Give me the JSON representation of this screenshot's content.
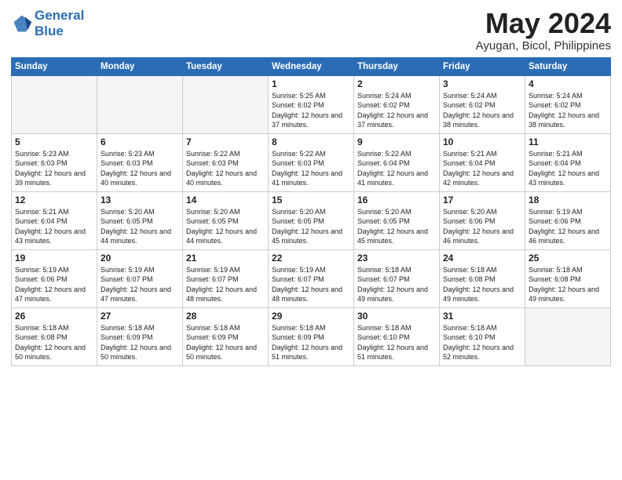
{
  "header": {
    "logo_line1": "General",
    "logo_line2": "Blue",
    "month": "May 2024",
    "location": "Ayugan, Bicol, Philippines"
  },
  "weekdays": [
    "Sunday",
    "Monday",
    "Tuesday",
    "Wednesday",
    "Thursday",
    "Friday",
    "Saturday"
  ],
  "weeks": [
    [
      {
        "day": "",
        "info": ""
      },
      {
        "day": "",
        "info": ""
      },
      {
        "day": "",
        "info": ""
      },
      {
        "day": "1",
        "info": "Sunrise: 5:25 AM\nSunset: 6:02 PM\nDaylight: 12 hours\nand 37 minutes."
      },
      {
        "day": "2",
        "info": "Sunrise: 5:24 AM\nSunset: 6:02 PM\nDaylight: 12 hours\nand 37 minutes."
      },
      {
        "day": "3",
        "info": "Sunrise: 5:24 AM\nSunset: 6:02 PM\nDaylight: 12 hours\nand 38 minutes."
      },
      {
        "day": "4",
        "info": "Sunrise: 5:24 AM\nSunset: 6:02 PM\nDaylight: 12 hours\nand 38 minutes."
      }
    ],
    [
      {
        "day": "5",
        "info": "Sunrise: 5:23 AM\nSunset: 6:03 PM\nDaylight: 12 hours\nand 39 minutes."
      },
      {
        "day": "6",
        "info": "Sunrise: 5:23 AM\nSunset: 6:03 PM\nDaylight: 12 hours\nand 40 minutes."
      },
      {
        "day": "7",
        "info": "Sunrise: 5:22 AM\nSunset: 6:03 PM\nDaylight: 12 hours\nand 40 minutes."
      },
      {
        "day": "8",
        "info": "Sunrise: 5:22 AM\nSunset: 6:03 PM\nDaylight: 12 hours\nand 41 minutes."
      },
      {
        "day": "9",
        "info": "Sunrise: 5:22 AM\nSunset: 6:04 PM\nDaylight: 12 hours\nand 41 minutes."
      },
      {
        "day": "10",
        "info": "Sunrise: 5:21 AM\nSunset: 6:04 PM\nDaylight: 12 hours\nand 42 minutes."
      },
      {
        "day": "11",
        "info": "Sunrise: 5:21 AM\nSunset: 6:04 PM\nDaylight: 12 hours\nand 43 minutes."
      }
    ],
    [
      {
        "day": "12",
        "info": "Sunrise: 5:21 AM\nSunset: 6:04 PM\nDaylight: 12 hours\nand 43 minutes."
      },
      {
        "day": "13",
        "info": "Sunrise: 5:20 AM\nSunset: 6:05 PM\nDaylight: 12 hours\nand 44 minutes."
      },
      {
        "day": "14",
        "info": "Sunrise: 5:20 AM\nSunset: 6:05 PM\nDaylight: 12 hours\nand 44 minutes."
      },
      {
        "day": "15",
        "info": "Sunrise: 5:20 AM\nSunset: 6:05 PM\nDaylight: 12 hours\nand 45 minutes."
      },
      {
        "day": "16",
        "info": "Sunrise: 5:20 AM\nSunset: 6:05 PM\nDaylight: 12 hours\nand 45 minutes."
      },
      {
        "day": "17",
        "info": "Sunrise: 5:20 AM\nSunset: 6:06 PM\nDaylight: 12 hours\nand 46 minutes."
      },
      {
        "day": "18",
        "info": "Sunrise: 5:19 AM\nSunset: 6:06 PM\nDaylight: 12 hours\nand 46 minutes."
      }
    ],
    [
      {
        "day": "19",
        "info": "Sunrise: 5:19 AM\nSunset: 6:06 PM\nDaylight: 12 hours\nand 47 minutes."
      },
      {
        "day": "20",
        "info": "Sunrise: 5:19 AM\nSunset: 6:07 PM\nDaylight: 12 hours\nand 47 minutes."
      },
      {
        "day": "21",
        "info": "Sunrise: 5:19 AM\nSunset: 6:07 PM\nDaylight: 12 hours\nand 48 minutes."
      },
      {
        "day": "22",
        "info": "Sunrise: 5:19 AM\nSunset: 6:07 PM\nDaylight: 12 hours\nand 48 minutes."
      },
      {
        "day": "23",
        "info": "Sunrise: 5:18 AM\nSunset: 6:07 PM\nDaylight: 12 hours\nand 49 minutes."
      },
      {
        "day": "24",
        "info": "Sunrise: 5:18 AM\nSunset: 6:08 PM\nDaylight: 12 hours\nand 49 minutes."
      },
      {
        "day": "25",
        "info": "Sunrise: 5:18 AM\nSunset: 6:08 PM\nDaylight: 12 hours\nand 49 minutes."
      }
    ],
    [
      {
        "day": "26",
        "info": "Sunrise: 5:18 AM\nSunset: 6:08 PM\nDaylight: 12 hours\nand 50 minutes."
      },
      {
        "day": "27",
        "info": "Sunrise: 5:18 AM\nSunset: 6:09 PM\nDaylight: 12 hours\nand 50 minutes."
      },
      {
        "day": "28",
        "info": "Sunrise: 5:18 AM\nSunset: 6:09 PM\nDaylight: 12 hours\nand 50 minutes."
      },
      {
        "day": "29",
        "info": "Sunrise: 5:18 AM\nSunset: 6:09 PM\nDaylight: 12 hours\nand 51 minutes."
      },
      {
        "day": "30",
        "info": "Sunrise: 5:18 AM\nSunset: 6:10 PM\nDaylight: 12 hours\nand 51 minutes."
      },
      {
        "day": "31",
        "info": "Sunrise: 5:18 AM\nSunset: 6:10 PM\nDaylight: 12 hours\nand 52 minutes."
      },
      {
        "day": "",
        "info": ""
      }
    ]
  ]
}
